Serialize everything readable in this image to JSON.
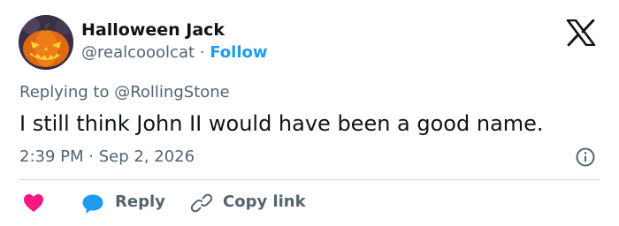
{
  "author": {
    "name": "Halloween Jack",
    "handle": "@realcooolcat",
    "separator": "·",
    "follow_label": "Follow",
    "avatar_icon": "jack-o-lantern-icon"
  },
  "platform": {
    "logo_icon": "x-logo-icon"
  },
  "tweet": {
    "replying_prefix": "Replying to",
    "replying_handle": "@RollingStone",
    "text": "I still think John II would have been a good name.",
    "time": "2:39 PM",
    "separator": "·",
    "date": "Sep 2, 2026",
    "info_icon": "info-icon"
  },
  "actions": {
    "like_icon": "heart-icon",
    "reply_icon": "speech-bubble-icon",
    "reply_label": "Reply",
    "copy_icon": "link-icon",
    "copy_label": "Copy link"
  },
  "colors": {
    "accent": "#1d9bf0",
    "heart": "#f91880",
    "text_primary": "#0f1419",
    "text_secondary": "#536471",
    "divider": "#cfd9de"
  }
}
